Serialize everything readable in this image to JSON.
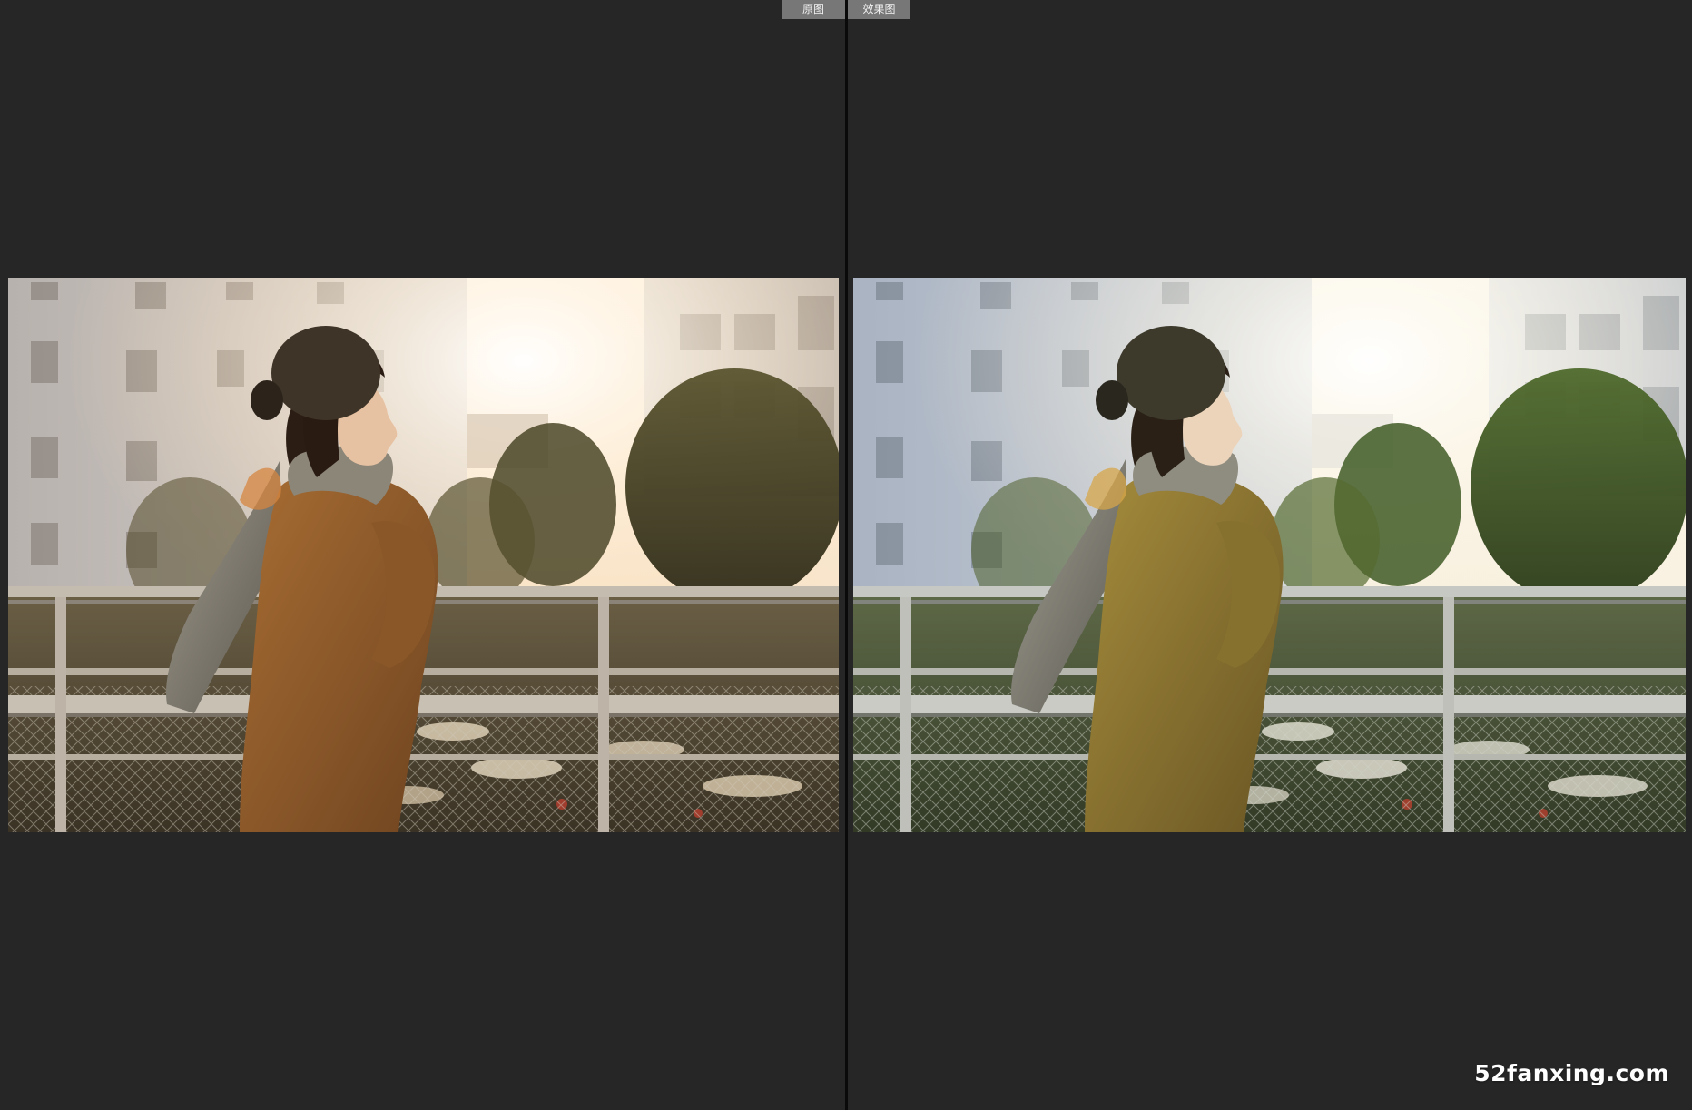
{
  "tabs": {
    "before_label": "原图",
    "after_label": "效果图"
  },
  "watermark": {
    "text": "52fanxing.com"
  },
  "colors": {
    "background": "#262626",
    "divider": "#0a0a0a",
    "tab_bg": "#777777",
    "tab_text": "#f0f0f0",
    "watermark_text": "#ffffff"
  },
  "photos": {
    "before": {
      "name": "before-photo",
      "tone": "warm-orange"
    },
    "after": {
      "name": "after-photo",
      "tone": "yellow-green"
    }
  }
}
